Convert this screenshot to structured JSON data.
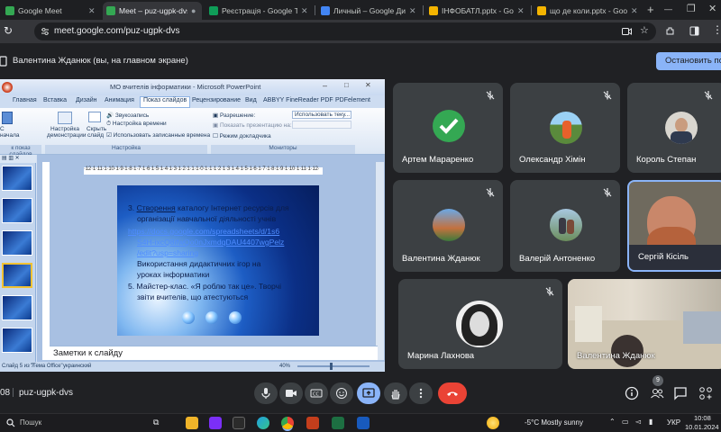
{
  "browser": {
    "tabs": [
      {
        "title": "Google Meet",
        "color": "#34a853"
      },
      {
        "title": "Meet – puz-ugpk-dvs",
        "color": "#34a853"
      },
      {
        "title": "Реєстрація - Google Табл",
        "color": "#0f9d58"
      },
      {
        "title": "Личный – Google Диск",
        "color": "#4285f4"
      },
      {
        "title": "ІНФОБАТЛ.pptx - Google",
        "color": "#f4b400"
      },
      {
        "title": "що де коли.pptx - Google",
        "color": "#f4b400"
      }
    ],
    "url": "meet.google.com/puz-ugpk-dvs"
  },
  "meet": {
    "presenter_text": "Валентина Жданюк (вы, на главном экране)",
    "stop_button": "Остановить показ",
    "meeting_code": "puz-ugpk-dvs",
    "time_fragment": "08",
    "participants_badge": "9"
  },
  "ppt": {
    "window_title": "МО вчителів інформатики - Microsoft PowerPoint",
    "ribbon_tabs": [
      "Главная",
      "Вставка",
      "Дизайн",
      "Анимация",
      "Показ слайдов",
      "Рецензирование",
      "Вид",
      "ABBYY FineReader PDF",
      "PDFelement"
    ],
    "active_tab": "Показ слайдов",
    "ribbon": {
      "item1": "Звукозапись",
      "item2": "Настройка времени",
      "item3": "Использовать записанные времена",
      "item4": "Разрешение:",
      "item5": "Использовать теку...",
      "item6": "Показать презентацию на:",
      "item7": "Режим докладчика",
      "btn1": "Настройка",
      "btn1b": "демонстрации",
      "btn2": "Скрыть",
      "btn2b": "слайд",
      "left_label": "С",
      "left_label2": "начала",
      "group1": "к показ слайдов",
      "group2": "Настройка",
      "group3": "Мониторы"
    },
    "slide": {
      "line1a": "3. ",
      "line1b": "Створення",
      "line1c": " каталогу Інтернет ресурсів для",
      "line2": "організації навчальної діяльності учнів",
      "link1": "https://docs.google.com/spreadsheets/d/1s6",
      "link2": "S4H-ixcQ8ifwQo0nJxmdqDAU4407wgPelz",
      "link3": "/edit?usp=sharing",
      "line3": "Використання дидактичних ігор на",
      "line4": "уроках інформатики",
      "line5": "5. Майстер-клас. «Я роблю так це». Творчі",
      "line6": "звіти вчителів, що атестуються"
    },
    "notes": "Заметки к слайду",
    "status_slide": "Слайд 5 из 7",
    "status_theme": "\"Тема Office\"",
    "status_lang": "украинский",
    "zoom": "40%",
    "ruler": "·12·1·11·1·10·1·9·1·8·1·7·1·6·1·5·1·4·1·3·1·2·1·1·1·0·1·1·1·2·1·3·1·4·1·5·1·6·1·7·1·8·1·9·1·10·1·11·1·12·"
  },
  "participants": [
    {
      "name": "Артем Мараренко",
      "bg": "#3c4043"
    },
    {
      "name": "Олександр Хімін",
      "bg": "#3c4043"
    },
    {
      "name": "Король Степан",
      "bg": "#3c4043"
    },
    {
      "name": "Валентина Жданюк",
      "bg": "#3c4043"
    },
    {
      "name": "Валерій Антоненко",
      "bg": "#3c4043"
    },
    {
      "name": "Сергій Кісіль",
      "bg": "#3c4043"
    },
    {
      "name": "Марина Лахнова",
      "bg": "#3c4043"
    },
    {
      "name": "Валентина Жданюк",
      "bg": "#3c4043"
    }
  ],
  "taskbar": {
    "search": "Пошук",
    "weather": "-5°C  Mostly sunny",
    "lang": "УКР",
    "time": "10:08",
    "date": "10.01.2024"
  },
  "colors": {
    "accent": "#8ab4f8",
    "end_call": "#ea4335",
    "present_active": "#8ab4f8"
  }
}
